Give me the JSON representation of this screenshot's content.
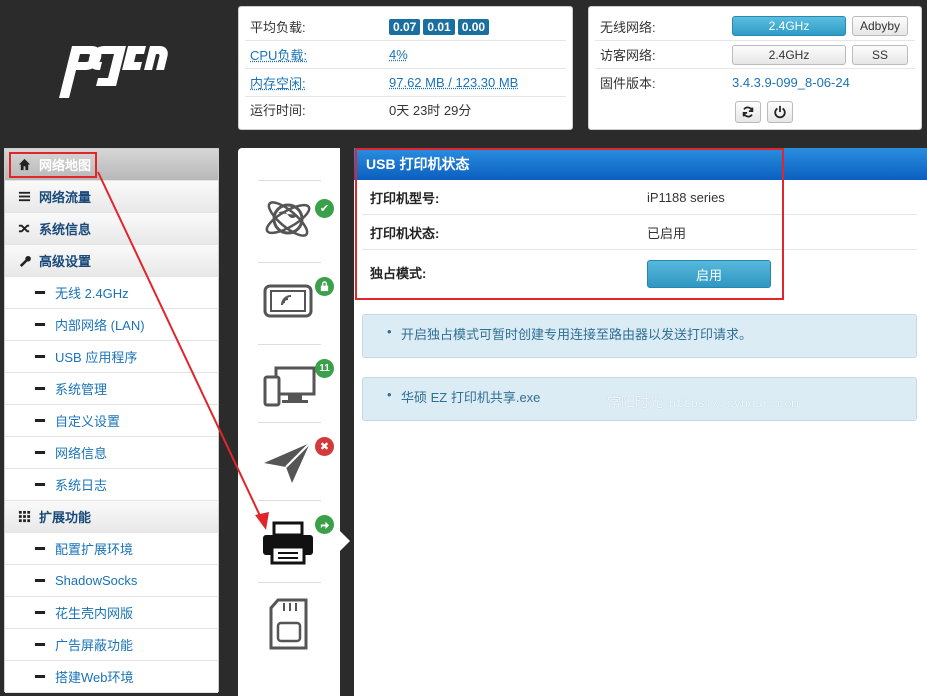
{
  "logo": {
    "text": "pdcn"
  },
  "status": {
    "load_label": "平均负载:",
    "load_values": [
      "0.07",
      "0.01",
      "0.00"
    ],
    "cpu_label": "CPU负载:",
    "cpu_value": "4%",
    "mem_label": "内存空闲:",
    "mem_value": "97.62 MB / 123.30 MB",
    "uptime_label": "运行时间:",
    "uptime_value": "0天 23时 29分"
  },
  "network": {
    "wireless_label": "无线网络:",
    "wireless_btn": "2.4GHz",
    "adbyby_btn": "Adbyby",
    "guest_label": "访客网络:",
    "guest_btn": "2.4GHz",
    "ss_btn": "SS",
    "firmware_label": "固件版本:",
    "firmware_value": "3.4.3.9-099_8-06-24",
    "refresh_icon": "refresh-icon",
    "power_icon": "power-icon"
  },
  "sidebar": {
    "items": [
      {
        "label": "网络地图",
        "type": "top",
        "icon": "home-icon",
        "active": true
      },
      {
        "label": "网络流量",
        "type": "top",
        "icon": "traffic-icon"
      },
      {
        "label": "系统信息",
        "type": "top",
        "icon": "shuffle-icon"
      },
      {
        "label": "高级设置",
        "type": "top",
        "icon": "wrench-icon"
      },
      {
        "label": "无线 2.4GHz",
        "type": "sub"
      },
      {
        "label": "内部网络 (LAN)",
        "type": "sub"
      },
      {
        "label": "USB 应用程序",
        "type": "sub"
      },
      {
        "label": "系统管理",
        "type": "sub"
      },
      {
        "label": "自定义设置",
        "type": "sub"
      },
      {
        "label": "网络信息",
        "type": "sub"
      },
      {
        "label": "系统日志",
        "type": "sub"
      },
      {
        "label": "扩展功能",
        "type": "top",
        "icon": "grid-icon"
      },
      {
        "label": "配置扩展环境",
        "type": "sub"
      },
      {
        "label": "ShadowSocks",
        "type": "sub"
      },
      {
        "label": "花生壳内网版",
        "type": "sub"
      },
      {
        "label": "广告屏蔽功能",
        "type": "sub"
      },
      {
        "label": "搭建Web环境",
        "type": "sub"
      }
    ]
  },
  "icons": {
    "internet_status": "✔",
    "lock_status": "lock",
    "clients_count": "11",
    "vpn_status": "✖",
    "printer_status": "share"
  },
  "main": {
    "title": "USB 打印机状态",
    "rows": [
      {
        "key": "打印机型号:",
        "value": "iP1188 series"
      },
      {
        "key": "打印机状态:",
        "value": "已启用"
      },
      {
        "key": "独占模式:",
        "value": ""
      }
    ],
    "enable_btn": "启用",
    "info1": "开启独占模式可暂时创建专用连接至路由器以发送打印请求。",
    "info2": "华硕 EZ 打印机共享.exe",
    "watermark_cn": "常阳时光",
    "watermark_url": "https://cyhour.com"
  },
  "colors": {
    "header_blue": "#0b5fbf",
    "highlight_red": "#e0262b",
    "badge_blue": "#1b6fa0",
    "btn_cyan": "#2f97c2"
  }
}
